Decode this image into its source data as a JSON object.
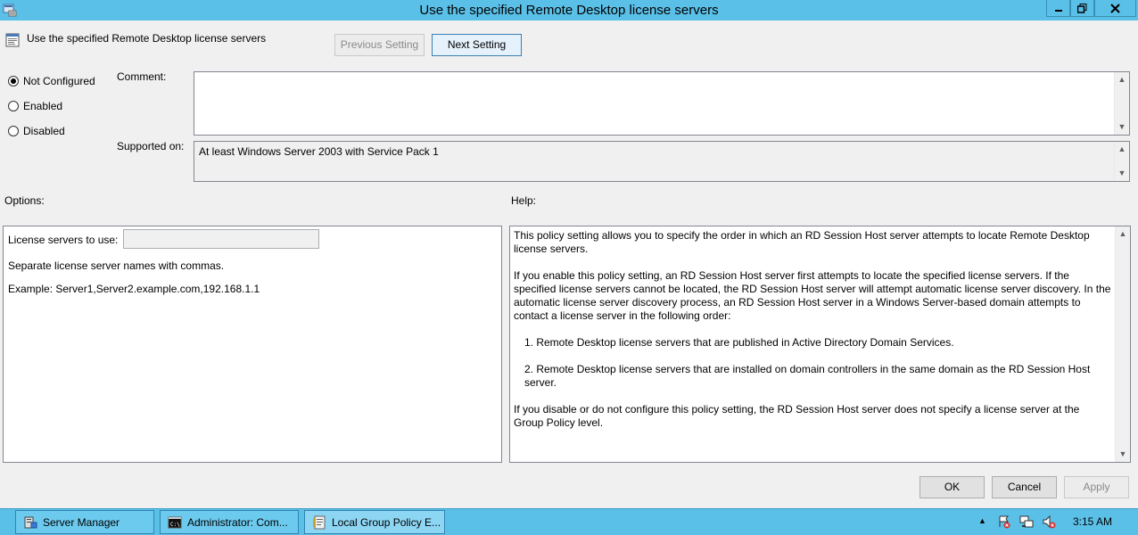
{
  "window": {
    "title": "Use the specified Remote Desktop license servers"
  },
  "header": {
    "setting_name": "Use the specified Remote Desktop license servers",
    "previous_label": "Previous Setting",
    "next_label": "Next Setting"
  },
  "state": {
    "options": [
      {
        "label": "Not Configured",
        "checked": true
      },
      {
        "label": "Enabled",
        "checked": false
      },
      {
        "label": "Disabled",
        "checked": false
      }
    ]
  },
  "labels": {
    "comment": "Comment:",
    "supported_on": "Supported on:",
    "options": "Options:",
    "help": "Help:"
  },
  "supported_on_value": "At least Windows Server 2003 with Service Pack 1",
  "comment_value": "",
  "options_panel": {
    "license_label": "License servers to use:",
    "license_value": "",
    "note": "Separate license server names with commas.",
    "example": "Example: Server1,Server2.example.com,192.168.1.1"
  },
  "help_panel": {
    "p1": "This policy setting allows you to specify the order in which an RD Session Host server attempts to locate Remote Desktop license servers.",
    "p2": "If you enable this policy setting, an RD Session Host server first attempts to locate the specified license servers. If the specified license servers cannot be located, the RD Session Host server will attempt automatic license server discovery. In the automatic license server discovery process, an RD Session Host server in a Windows Server-based domain attempts to contact a license server in the following order:",
    "item1": "1. Remote Desktop license servers that are published in Active Directory Domain Services.",
    "item2": "2. Remote Desktop license servers that are installed on domain controllers in the same domain as the RD Session Host server.",
    "p3": "If you disable or do not configure this policy setting, the RD Session Host server does not specify a license server at the Group Policy level."
  },
  "footer": {
    "ok": "OK",
    "cancel": "Cancel",
    "apply": "Apply"
  },
  "taskbar": {
    "items": [
      {
        "label": "Server Manager",
        "icon": "server-manager-icon"
      },
      {
        "label": "Administrator: Com...",
        "icon": "command-prompt-icon"
      },
      {
        "label": "Local Group Policy E...",
        "icon": "group-policy-icon"
      }
    ],
    "clock": "3:15 AM"
  },
  "colors": {
    "titlebar": "#5bc0e8",
    "taskbar": "#5bc0e8",
    "background": "#f0f0f0"
  }
}
